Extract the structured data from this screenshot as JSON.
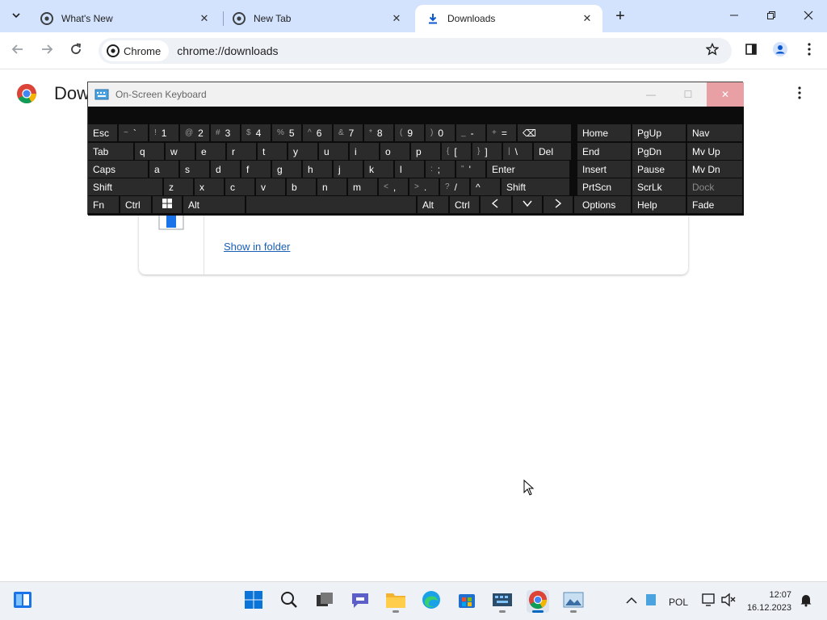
{
  "tabs": [
    {
      "title": "What's New",
      "icon": "chrome-icon"
    },
    {
      "title": "New Tab",
      "icon": "chrome-icon"
    },
    {
      "title": "Downloads",
      "icon": "download-icon",
      "active": true
    }
  ],
  "omnibox": {
    "chip_label": "Chrome",
    "url": "chrome://downloads"
  },
  "page": {
    "title": "Dow",
    "download_item": {
      "show_in_folder_label": "Show in folder"
    }
  },
  "osk": {
    "title": "On-Screen Keyboard",
    "rows": {
      "row1": [
        [
          "",
          "Esc"
        ],
        [
          "~",
          "`"
        ],
        [
          "!",
          "1"
        ],
        [
          "@",
          "2"
        ],
        [
          "#",
          "3"
        ],
        [
          "$",
          "4"
        ],
        [
          "%",
          "5"
        ],
        [
          "^",
          "6"
        ],
        [
          "&",
          "7"
        ],
        [
          "*",
          "8"
        ],
        [
          "(",
          "9"
        ],
        [
          ")",
          "0"
        ],
        [
          "_",
          "-"
        ],
        [
          "+",
          "="
        ],
        [
          "",
          "⌫"
        ]
      ],
      "row2": [
        "Tab",
        "q",
        "w",
        "e",
        "r",
        "t",
        "y",
        "u",
        "i",
        "o",
        "p",
        "{ [",
        "} ]",
        "| \\",
        "Del"
      ],
      "row3": [
        "Caps",
        "a",
        "s",
        "d",
        "f",
        "g",
        "h",
        "j",
        "k",
        "l",
        ": ;",
        "\" '",
        "Enter"
      ],
      "row4": [
        "Shift",
        "z",
        "x",
        "c",
        "v",
        "b",
        "n",
        "m",
        "< ,",
        "> .",
        "? /",
        "^",
        "Shift"
      ],
      "row5": [
        "Fn",
        "Ctrl",
        "win",
        "Alt",
        "",
        "Alt",
        "Ctrl",
        "<",
        "v",
        ">",
        "menu"
      ]
    },
    "nav_keys": [
      [
        "Home",
        "PgUp",
        "Nav"
      ],
      [
        "End",
        "PgDn",
        "Mv Up"
      ],
      [
        "Insert",
        "Pause",
        "Mv Dn"
      ],
      [
        "PrtScn",
        "ScrLk",
        "Dock"
      ],
      [
        "Options",
        "Help",
        "Fade"
      ]
    ]
  },
  "taskbar": {
    "lang": "POL",
    "time": "12:07",
    "date": "16.12.2023"
  },
  "colors": {
    "tabstrip": "#d3e3fd",
    "osk_bg": "#0c0c0c",
    "key_bg": "#2b2b2b",
    "accent": "#0067c0"
  }
}
